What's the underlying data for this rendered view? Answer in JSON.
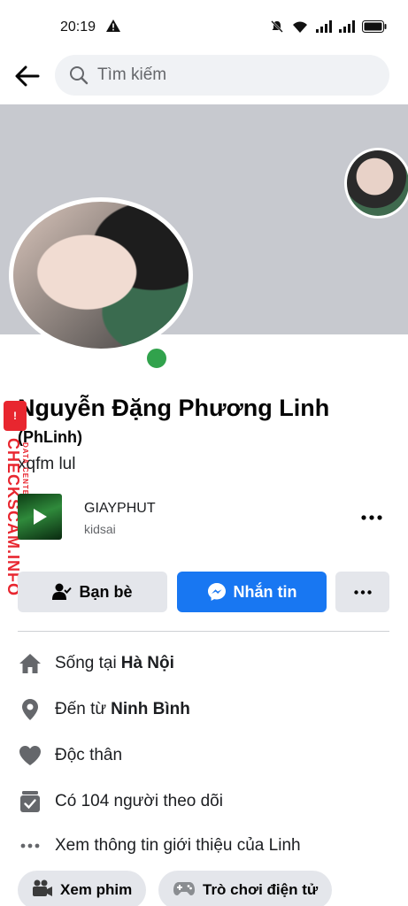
{
  "status_bar": {
    "time": "20:19"
  },
  "search": {
    "placeholder": "Tìm kiếm"
  },
  "profile": {
    "name": "Nguyễn Đặng Phương Linh",
    "alt_name": "(PhLinh)",
    "bio": "xqfm lul",
    "online": true
  },
  "music": {
    "title": "GIAYPHUT",
    "artist": "kidsai"
  },
  "actions": {
    "friends_label": "Bạn bè",
    "message_label": "Nhắn tin",
    "more_label": "•••"
  },
  "intro": {
    "lives_prefix": "Sống tại",
    "lives_value": "Hà Nội",
    "from_prefix": "Đến từ",
    "from_value": "Ninh Bình",
    "relationship": "Độc thân",
    "followers": "Có 104 người theo dõi",
    "see_more": "Xem thông tin giới thiệu của Linh"
  },
  "chips": [
    {
      "label": "Xem phim",
      "icon": "film-camera-icon"
    },
    {
      "label": "Trò chơi điện tử",
      "icon": "gamepad-icon"
    }
  ],
  "watermark": {
    "main": "CHECKSCAM.INFO",
    "sub": "DATA CENTER",
    "badge": "!"
  },
  "colors": {
    "accent": "#1877f2",
    "online": "#31a24c",
    "watermark": "#e8262f",
    "cover": "#c7c9cf"
  }
}
